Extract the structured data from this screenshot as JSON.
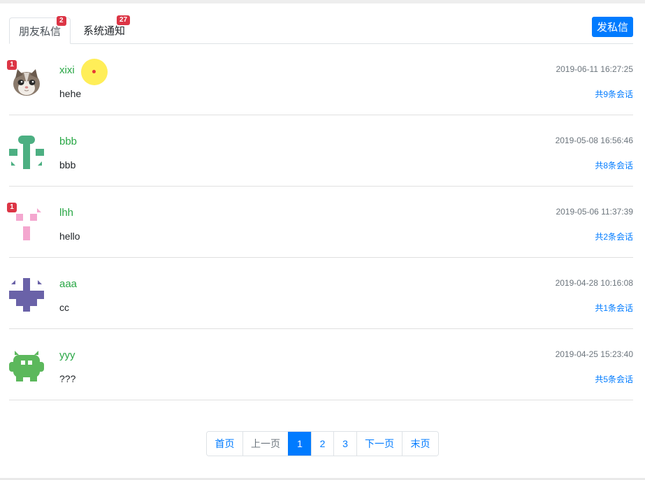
{
  "tabs": [
    {
      "label": "朋友私信",
      "badge": "2",
      "active": true
    },
    {
      "label": "系统通知",
      "badge": "27",
      "active": false
    }
  ],
  "send_button": "发私信",
  "messages": [
    {
      "username": "xixi",
      "preview": "hehe",
      "time": "2019-06-11 16:27:25",
      "count": "共9条会话",
      "unread": "1",
      "avatar": "cat-photo"
    },
    {
      "username": "bbb",
      "preview": "bbb",
      "time": "2019-05-08 16:56:46",
      "count": "共8条会话",
      "unread": null,
      "avatar": "identicon-green"
    },
    {
      "username": "lhh",
      "preview": "hello",
      "time": "2019-05-06 11:37:39",
      "count": "共2条会话",
      "unread": "1",
      "avatar": "identicon-pink"
    },
    {
      "username": "aaa",
      "preview": "cc",
      "time": "2019-04-28 10:16:08",
      "count": "共1条会话",
      "unread": null,
      "avatar": "identicon-purple"
    },
    {
      "username": "yyy",
      "preview": "???",
      "time": "2019-04-25 15:23:40",
      "count": "共5条会话",
      "unread": null,
      "avatar": "identicon-lime"
    }
  ],
  "pagination": {
    "first": "首页",
    "prev": "上一页",
    "pages": [
      "1",
      "2",
      "3"
    ],
    "current": "1",
    "next": "下一页",
    "last": "末页"
  },
  "colors": {
    "accent": "#007bff",
    "username": "#28a745",
    "badge": "#dc3545",
    "identicon_green": "#4caf82",
    "identicon_pink": "#f4a7cf",
    "identicon_purple": "#6a62a8",
    "identicon_lime": "#5cb85c"
  }
}
